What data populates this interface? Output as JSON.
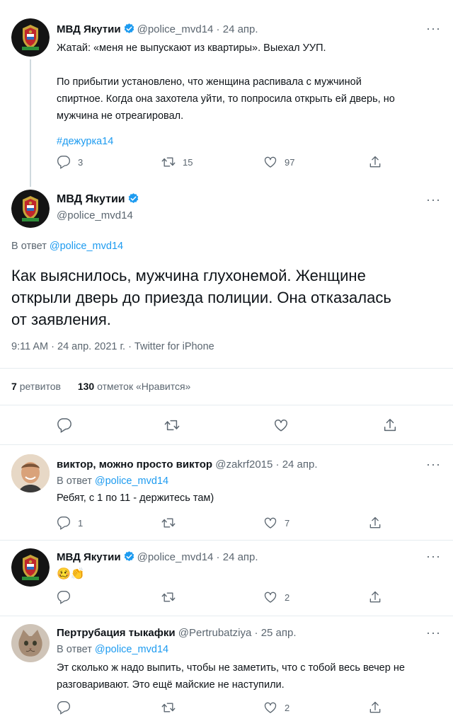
{
  "author": {
    "name": "МВД Якутии",
    "handle": "@police_mvd14"
  },
  "tweet1": {
    "date": "24 апр.",
    "text": [
      "Жатай: «меня не выпускают из квартиры». Выехал УУП.",
      "",
      "По прибытии установлено, что женщина распивала с мужчиной",
      "спиртное. Когда она захотела уйти, то попросила открыть ей дверь, но",
      "мужчина не отреагировал."
    ],
    "hashtag": "#дежурка14",
    "replies": "3",
    "retweets": "15",
    "likes": "97"
  },
  "main": {
    "reply_to_prefix": "В ответ",
    "reply_to_handle": "@police_mvd14",
    "text": [
      "Как выяснилось, мужчина глухонемой. Женщине",
      "открыли дверь до приезда полиции. Она отказалась",
      "от заявления."
    ],
    "meta": "9:11 AM · 24 апр. 2021 г. · Twitter for iPhone",
    "retweets_count": "7",
    "retweets_label": "ретвитов",
    "likes_count": "130",
    "likes_label": "отметок «Нравится»"
  },
  "reply1": {
    "name": "виктор, можно просто виктор",
    "handle": "@zakrf2015",
    "date": "24 апр.",
    "reply_to_prefix": "В ответ",
    "reply_to_handle": "@police_mvd14",
    "text": "Ребят, с 1 по 11 - держитесь там)",
    "replies": "1",
    "likes": "7"
  },
  "reply2": {
    "date": "24 апр.",
    "emoji": "🥴👏",
    "likes": "2"
  },
  "reply3": {
    "name": "Пертрубация тыкафки",
    "handle": "@Pertrubatziya",
    "date": "25 апр.",
    "reply_to_prefix": "В ответ",
    "reply_to_handle": "@police_mvd14",
    "text": [
      "Эт сколько ж надо выпить, чтобы не заметить, что с тобой весь вечер не",
      "разговаривают. Это ещё майские не наступили."
    ],
    "likes": "2"
  },
  "colors": {
    "accent": "#1d9bf0",
    "secondary": "#5b6670",
    "separator": "#e6ecf0"
  }
}
